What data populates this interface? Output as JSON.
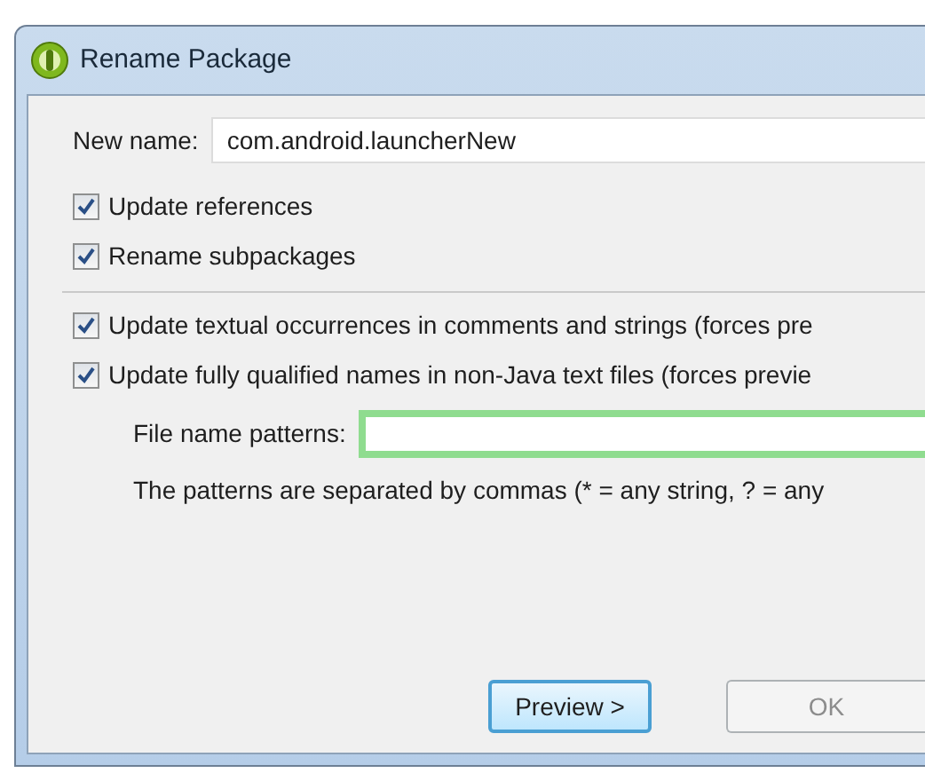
{
  "window": {
    "title": "Rename Package"
  },
  "new_name": {
    "label": "New name:",
    "value": "com.android.launcherNew"
  },
  "options": [
    {
      "label": "Update references",
      "checked": true
    },
    {
      "label": "Rename subpackages",
      "checked": true
    }
  ],
  "more_options": [
    {
      "label": "Update textual occurrences in comments and strings (forces pre",
      "checked": true
    },
    {
      "label": "Update fully qualified names in non-Java text files (forces previe",
      "checked": true
    }
  ],
  "file_patterns": {
    "label": "File name patterns:",
    "focused": true,
    "hint": "The patterns are separated by commas (* = any string, ? = any"
  },
  "buttons": [
    {
      "label": "Preview >",
      "kind": "default",
      "disabled": false
    },
    {
      "label": "OK",
      "kind": "normal",
      "disabled": true
    }
  ]
}
